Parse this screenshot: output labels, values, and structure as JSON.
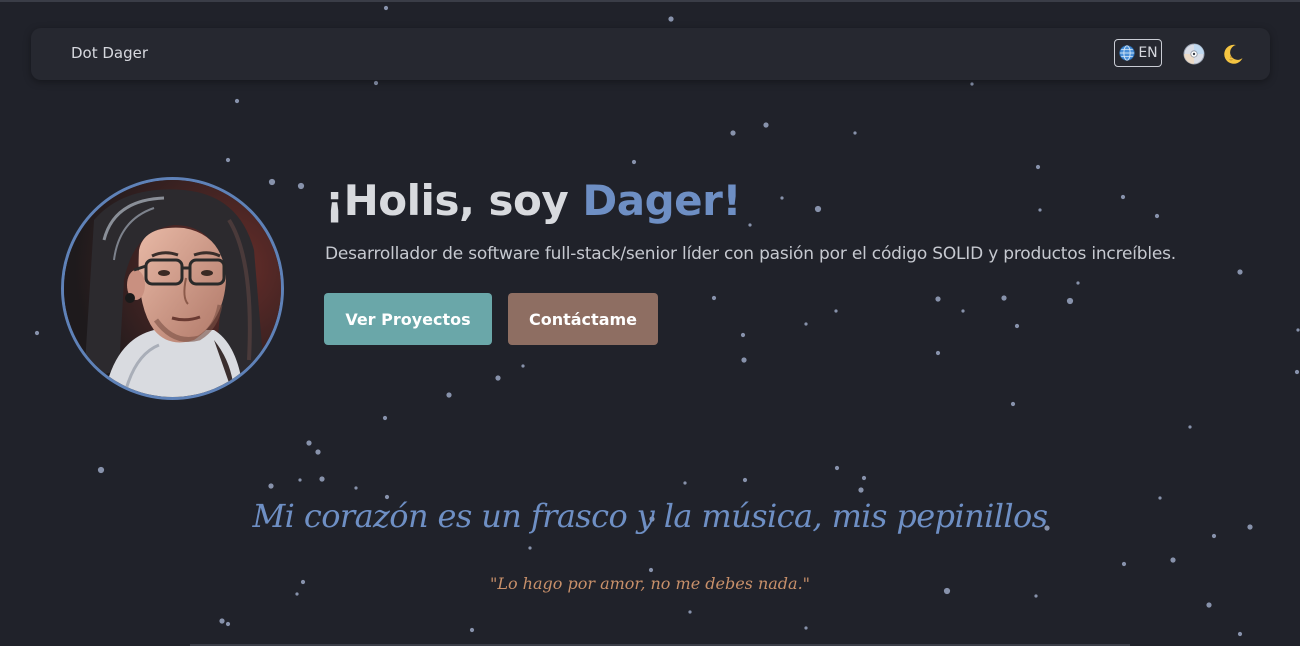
{
  "navbar": {
    "brand": "Dot Dager",
    "language_label": "EN",
    "language_icon": "globe-icon",
    "music_icon": "disc-icon",
    "theme_icon": "moon-icon"
  },
  "hero": {
    "greeting": "¡Holis, soy ",
    "name": "Dager!",
    "subtitle": "Desarrollador de software full-stack/senior líder con pasión por el código SOLID y productos increíbles.",
    "projects_button": "Ver Proyectos",
    "contact_button": "Contáctame",
    "avatar_alt": "profile-photo"
  },
  "quote": {
    "main": "Mi corazón es un frasco y la música, mis pepinillos",
    "sub": "\"Lo hago por amor, no me debes nada.\""
  },
  "colors": {
    "background": "#20222a",
    "accent_blue": "#6e8fc4",
    "teal_button": "#6aa7a9",
    "brown_button": "#8e6e62",
    "quote_orange": "#c8906a",
    "star": "#9aa6c2"
  }
}
